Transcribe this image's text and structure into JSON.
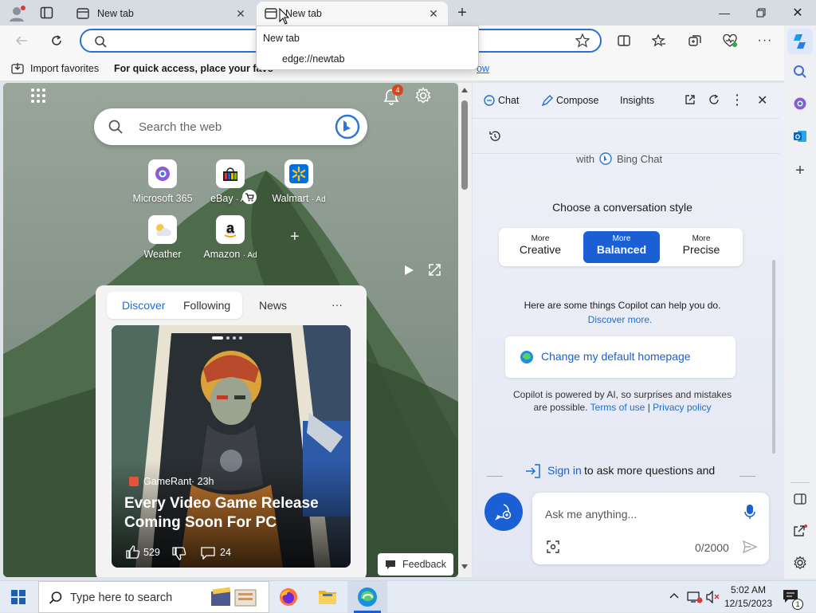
{
  "tabs": [
    {
      "label": "New tab"
    },
    {
      "label": "New tab",
      "active": true
    }
  ],
  "address": {
    "value": "",
    "placeholder": ""
  },
  "dropdown": {
    "title": "New tab",
    "url": "edge://newtab"
  },
  "favorites_bar": {
    "import": "Import favorites",
    "hint": "For quick access, place your favo",
    "hint_tail": "ow"
  },
  "ntp": {
    "notification_count": "4",
    "search_placeholder": "Search the web",
    "quick_links": [
      {
        "label": "Microsoft 365",
        "ad": ""
      },
      {
        "label": "eBay",
        "ad": "· Ad"
      },
      {
        "label": "Walmart",
        "ad": "· Ad"
      },
      {
        "label": "Weather",
        "ad": ""
      },
      {
        "label": "Amazon",
        "ad": "· Ad"
      }
    ],
    "feed_tabs": [
      "Discover",
      "Following",
      "News"
    ],
    "feed_more": "···",
    "article": {
      "source": "GameRant",
      "age": "· 23h",
      "title": "Every Video Game Release Coming Soon For PC",
      "likes": "529",
      "comments": "24"
    },
    "feedback": "Feedback"
  },
  "copilot": {
    "tabs": [
      "Chat",
      "Compose",
      "Insights"
    ],
    "with_bing": "with",
    "bing_chat": "Bing Chat",
    "style_heading": "Choose a conversation style",
    "styles": [
      {
        "small": "More",
        "big": "Creative"
      },
      {
        "small": "More",
        "big": "Balanced",
        "selected": true
      },
      {
        "small": "More",
        "big": "Precise"
      }
    ],
    "help_text": "Here are some things Copilot can help you do.",
    "discover_more": "Discover more.",
    "suggestion": "Change my default homepage",
    "disclaimer_1": "Copilot is powered by AI, so surprises and mistakes",
    "disclaimer_2": "are possible.",
    "terms": "Terms of use",
    "sep": "|",
    "privacy": "Privacy policy",
    "sign_in": "Sign in",
    "sign_in_rest": "to ask more questions and",
    "ask_placeholder": "Ask me anything...",
    "char_count": "0/2000"
  },
  "taskbar": {
    "search_placeholder": "Type here to search",
    "time": "5:02 AM",
    "date": "12/15/2023",
    "notif_count": "1"
  },
  "colors": {
    "accent": "#1b6ed6",
    "copilot_selected": "#1b5fd4"
  }
}
